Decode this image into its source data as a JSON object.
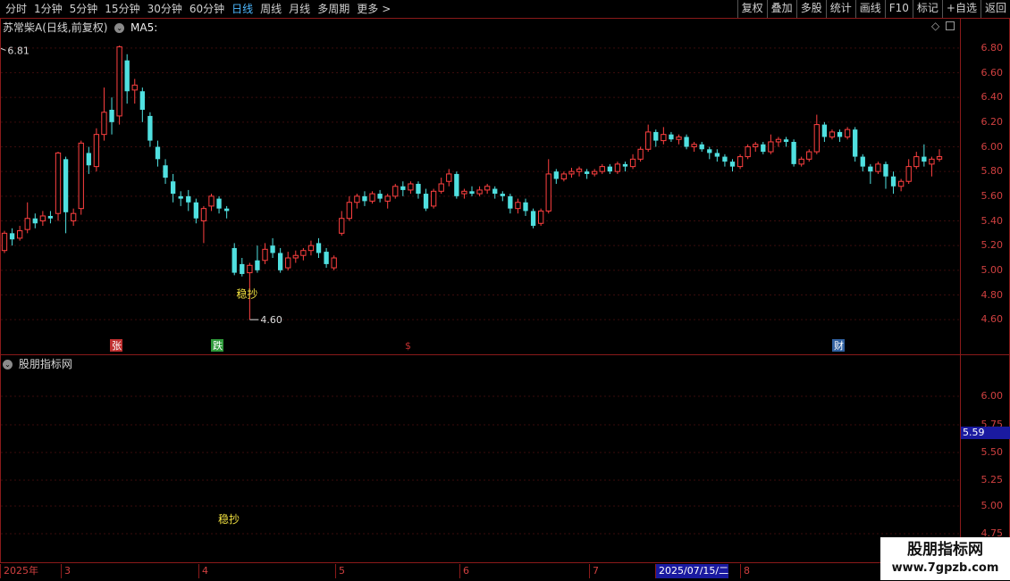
{
  "toolbar": {
    "periods": [
      "分时",
      "1分钟",
      "5分钟",
      "15分钟",
      "30分钟",
      "60分钟",
      "日线",
      "周线",
      "月线",
      "多周期",
      "更多"
    ],
    "active_period": "日线",
    "more_arrow": ">",
    "buttons": [
      "复权",
      "叠加",
      "多股",
      "统计",
      "画线",
      "F10",
      "标记",
      "+自选",
      "返回"
    ]
  },
  "main_chart": {
    "title": "苏常柴A(日线,前复权)",
    "indicator": "MA5:",
    "high_label": "6.81",
    "low_label": "4.60",
    "signal_label": "稳抄",
    "yaxis": [
      "6.80",
      "6.60",
      "6.40",
      "6.20",
      "6.00",
      "5.80",
      "5.60",
      "5.40",
      "5.20",
      "5.00",
      "4.80",
      "4.60"
    ],
    "markers": [
      {
        "text": "张",
        "color": "#c03030"
      },
      {
        "text": "跌",
        "color": "#2e9a3a"
      },
      {
        "text": "$",
        "color": "#c03030"
      },
      {
        "text": "财",
        "color": "#3060a0"
      }
    ],
    "colors": {
      "up": "#ff4040",
      "down": "#50e0e0",
      "grid": "#4a1010"
    }
  },
  "sub_chart": {
    "title": "股朋指标网",
    "signal_label": "稳抄",
    "yaxis": [
      "6.00",
      "5.75",
      "5.50",
      "5.25",
      "5.00",
      "4.75"
    ],
    "current_value": "5.59"
  },
  "xaxis": {
    "labels": [
      "2025年",
      "3",
      "4",
      "5",
      "6",
      "7",
      "2025/07/15/二",
      "8"
    ]
  },
  "watermark": {
    "title": "股朋指标网",
    "url": "www.7gpzb.com"
  },
  "chart_data": {
    "type": "candlestick",
    "ylim": [
      4.5,
      6.9
    ],
    "high": 6.81,
    "low": 4.6,
    "candles": [
      [
        5.16,
        5.3,
        5.14,
        5.32
      ],
      [
        5.3,
        5.25,
        5.2,
        5.34
      ],
      [
        5.26,
        5.32,
        5.24,
        5.36
      ],
      [
        5.33,
        5.42,
        5.3,
        5.55
      ],
      [
        5.42,
        5.38,
        5.34,
        5.46
      ],
      [
        5.4,
        5.44,
        5.36,
        5.48
      ],
      [
        5.44,
        5.42,
        5.38,
        5.48
      ],
      [
        5.46,
        5.95,
        5.4,
        5.96
      ],
      [
        5.9,
        5.47,
        5.3,
        5.92
      ],
      [
        5.4,
        5.46,
        5.36,
        5.5
      ],
      [
        5.5,
        6.03,
        5.45,
        6.05
      ],
      [
        5.95,
        5.85,
        5.78,
        6.0
      ],
      [
        5.84,
        6.1,
        5.8,
        6.15
      ],
      [
        6.1,
        6.28,
        6.05,
        6.48
      ],
      [
        6.3,
        6.2,
        6.1,
        6.4
      ],
      [
        6.25,
        6.81,
        6.18,
        6.82
      ],
      [
        6.7,
        6.45,
        6.35,
        6.75
      ],
      [
        6.46,
        6.5,
        6.35,
        6.55
      ],
      [
        6.45,
        6.3,
        6.2,
        6.48
      ],
      [
        6.25,
        6.05,
        6.0,
        6.28
      ],
      [
        6.0,
        5.9,
        5.84,
        6.05
      ],
      [
        5.85,
        5.75,
        5.7,
        5.9
      ],
      [
        5.72,
        5.62,
        5.55,
        5.78
      ],
      [
        5.6,
        5.58,
        5.52,
        5.64
      ],
      [
        5.6,
        5.55,
        5.48,
        5.65
      ],
      [
        5.55,
        5.42,
        5.38,
        5.58
      ],
      [
        5.4,
        5.5,
        5.22,
        5.52
      ],
      [
        5.52,
        5.6,
        5.48,
        5.62
      ],
      [
        5.58,
        5.5,
        5.46,
        5.6
      ],
      [
        5.5,
        5.48,
        5.42,
        5.52
      ],
      [
        5.18,
        4.98,
        4.96,
        5.22
      ],
      [
        5.05,
        4.97,
        4.95,
        5.1
      ],
      [
        4.98,
        5.04,
        4.6,
        5.06
      ],
      [
        5.08,
        5.0,
        4.98,
        5.2
      ],
      [
        5.08,
        5.17,
        5.05,
        5.22
      ],
      [
        5.2,
        5.14,
        5.1,
        5.26
      ],
      [
        5.14,
        5.0,
        4.98,
        5.18
      ],
      [
        5.02,
        5.1,
        5.0,
        5.15
      ],
      [
        5.1,
        5.12,
        5.06,
        5.16
      ],
      [
        5.12,
        5.16,
        5.08,
        5.18
      ],
      [
        5.16,
        5.2,
        5.12,
        5.24
      ],
      [
        5.22,
        5.14,
        5.1,
        5.26
      ],
      [
        5.15,
        5.05,
        5.02,
        5.18
      ],
      [
        5.02,
        5.1,
        5.0,
        5.12
      ],
      [
        5.3,
        5.42,
        5.28,
        5.48
      ],
      [
        5.42,
        5.55,
        5.4,
        5.6
      ],
      [
        5.55,
        5.6,
        5.5,
        5.62
      ],
      [
        5.6,
        5.56,
        5.52,
        5.64
      ],
      [
        5.56,
        5.62,
        5.54,
        5.64
      ],
      [
        5.62,
        5.58,
        5.55,
        5.65
      ],
      [
        5.56,
        5.6,
        5.5,
        5.62
      ],
      [
        5.6,
        5.68,
        5.58,
        5.7
      ],
      [
        5.68,
        5.65,
        5.6,
        5.72
      ],
      [
        5.65,
        5.7,
        5.62,
        5.72
      ],
      [
        5.7,
        5.62,
        5.58,
        5.72
      ],
      [
        5.62,
        5.5,
        5.48,
        5.66
      ],
      [
        5.52,
        5.64,
        5.5,
        5.66
      ],
      [
        5.64,
        5.7,
        5.62,
        5.75
      ],
      [
        5.72,
        5.78,
        5.68,
        5.82
      ],
      [
        5.78,
        5.6,
        5.58,
        5.8
      ],
      [
        5.62,
        5.64,
        5.58,
        5.66
      ],
      [
        5.64,
        5.62,
        5.6,
        5.68
      ],
      [
        5.62,
        5.65,
        5.6,
        5.68
      ],
      [
        5.65,
        5.68,
        5.62,
        5.7
      ],
      [
        5.66,
        5.62,
        5.58,
        5.68
      ],
      [
        5.62,
        5.6,
        5.56,
        5.64
      ],
      [
        5.6,
        5.5,
        5.46,
        5.62
      ],
      [
        5.5,
        5.55,
        5.46,
        5.58
      ],
      [
        5.55,
        5.48,
        5.44,
        5.58
      ],
      [
        5.48,
        5.36,
        5.34,
        5.5
      ],
      [
        5.38,
        5.48,
        5.36,
        5.5
      ],
      [
        5.48,
        5.78,
        5.46,
        5.9
      ],
      [
        5.8,
        5.74,
        5.7,
        5.82
      ],
      [
        5.74,
        5.78,
        5.72,
        5.8
      ],
      [
        5.78,
        5.8,
        5.75,
        5.83
      ],
      [
        5.8,
        5.82,
        5.76,
        5.84
      ],
      [
        5.8,
        5.78,
        5.74,
        5.82
      ],
      [
        5.78,
        5.8,
        5.76,
        5.82
      ],
      [
        5.8,
        5.84,
        5.78,
        5.86
      ],
      [
        5.84,
        5.8,
        5.78,
        5.86
      ],
      [
        5.8,
        5.86,
        5.78,
        5.88
      ],
      [
        5.86,
        5.84,
        5.8,
        5.88
      ],
      [
        5.84,
        5.9,
        5.82,
        5.94
      ],
      [
        5.9,
        5.98,
        5.88,
        6.0
      ],
      [
        5.98,
        6.12,
        5.96,
        6.18
      ],
      [
        6.12,
        6.05,
        6.0,
        6.14
      ],
      [
        6.05,
        6.1,
        6.02,
        6.16
      ],
      [
        6.1,
        6.06,
        6.04,
        6.12
      ],
      [
        6.06,
        6.08,
        6.02,
        6.1
      ],
      [
        6.08,
        6.0,
        5.98,
        6.1
      ],
      [
        6.0,
        6.02,
        5.96,
        6.04
      ],
      [
        6.02,
        5.98,
        5.96,
        6.04
      ],
      [
        5.98,
        5.95,
        5.9,
        6.0
      ],
      [
        5.95,
        5.92,
        5.88,
        5.98
      ],
      [
        5.92,
        5.88,
        5.84,
        5.94
      ],
      [
        5.88,
        5.84,
        5.8,
        5.9
      ],
      [
        5.84,
        5.92,
        5.82,
        5.94
      ],
      [
        5.92,
        6.0,
        5.9,
        6.02
      ],
      [
        6.0,
        6.02,
        5.96,
        6.04
      ],
      [
        6.02,
        5.96,
        5.94,
        6.04
      ],
      [
        5.96,
        6.04,
        5.94,
        6.1
      ],
      [
        6.04,
        6.06,
        6.0,
        6.08
      ],
      [
        6.06,
        6.04,
        6.0,
        6.08
      ],
      [
        6.04,
        5.86,
        5.84,
        6.06
      ],
      [
        5.86,
        5.9,
        5.84,
        5.92
      ],
      [
        5.9,
        5.96,
        5.88,
        5.98
      ],
      [
        5.96,
        6.18,
        5.94,
        6.26
      ],
      [
        6.18,
        6.08,
        6.04,
        6.2
      ],
      [
        6.08,
        6.12,
        6.06,
        6.14
      ],
      [
        6.12,
        6.08,
        6.04,
        6.14
      ],
      [
        6.08,
        6.14,
        6.06,
        6.16
      ],
      [
        6.14,
        5.92,
        5.88,
        6.16
      ],
      [
        5.92,
        5.84,
        5.8,
        5.94
      ],
      [
        5.84,
        5.8,
        5.7,
        5.86
      ],
      [
        5.8,
        5.86,
        5.78,
        5.88
      ],
      [
        5.86,
        5.76,
        5.66,
        5.88
      ],
      [
        5.76,
        5.68,
        5.62,
        5.8
      ],
      [
        5.68,
        5.72,
        5.64,
        5.74
      ],
      [
        5.72,
        5.84,
        5.7,
        5.9
      ],
      [
        5.84,
        5.92,
        5.82,
        5.96
      ],
      [
        5.92,
        5.88,
        5.84,
        6.02
      ],
      [
        5.86,
        5.9,
        5.76,
        5.92
      ],
      [
        5.9,
        5.92,
        5.88,
        5.98
      ]
    ]
  }
}
